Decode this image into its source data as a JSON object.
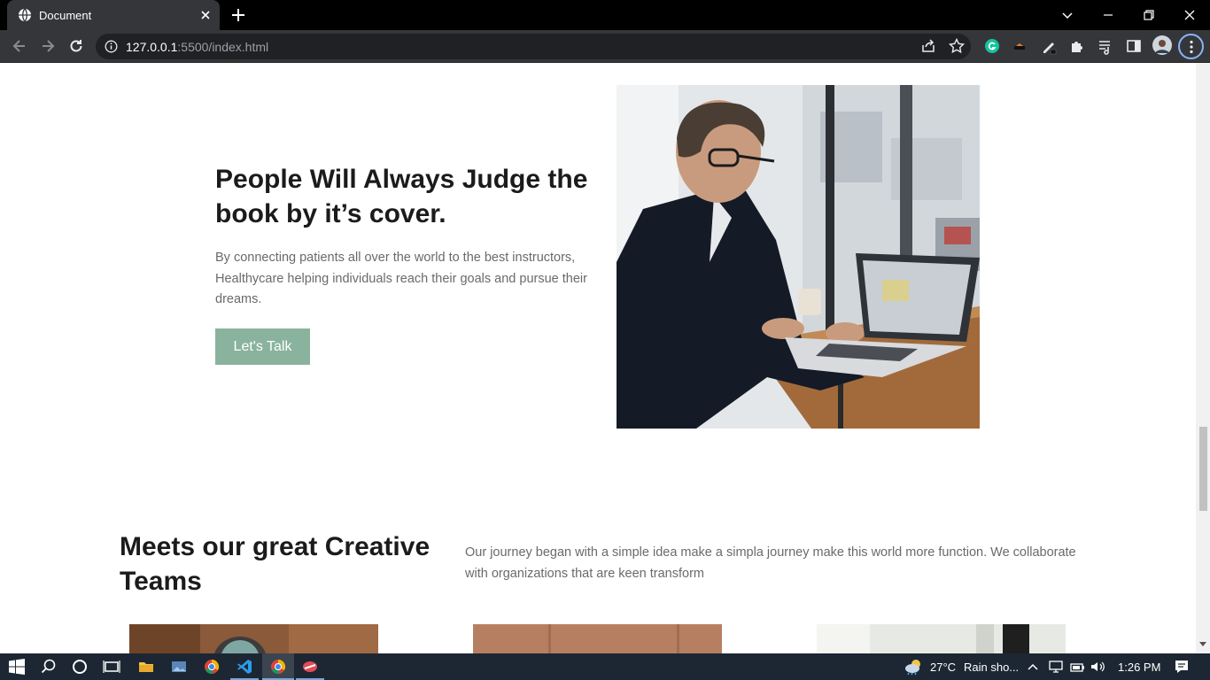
{
  "browser": {
    "tab_title": "Document",
    "url_host": "127.0.0.1",
    "url_rest": ":5500/index.html"
  },
  "hero": {
    "heading": "People Will Always Judge the book by it’s cover.",
    "text": "By connecting patients all over the world to the best instructors, Healthycare helping individuals reach their goals and pursue their dreams.",
    "button_label": "Let's Talk",
    "button_color": "#8ab39d"
  },
  "teams": {
    "heading": "Meets our great Creative Teams",
    "text": "Our journey began with a simple idea make a simpla journey make this world more function. We collaborate with organizations that are keen transform"
  },
  "taskbar": {
    "temperature": "27°C",
    "weather": "Rain sho...",
    "time": "1:26 PM"
  }
}
